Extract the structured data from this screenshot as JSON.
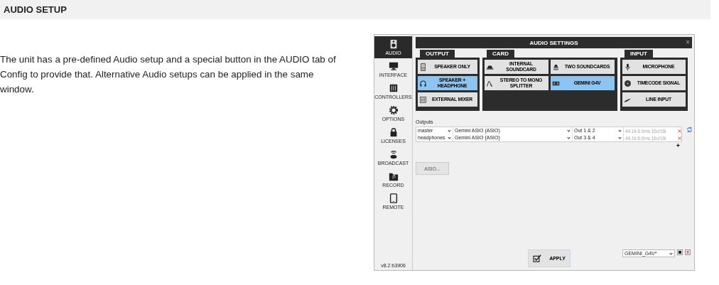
{
  "section_title": "AUDIO SETUP",
  "paragraph": "The unit has a pre-defined Audio setup and a special button in the AUDIO tab of Config to provide that. Alternative Audio setups can be applied in the same window.",
  "app": {
    "sidebar": [
      {
        "label": "AUDIO",
        "selected": true
      },
      {
        "label": "INTERFACE",
        "selected": false
      },
      {
        "label": "CONTROLLERS",
        "selected": false
      },
      {
        "label": "OPTIONS",
        "selected": false
      },
      {
        "label": "LICENSES",
        "selected": false
      },
      {
        "label": "BROADCAST",
        "selected": false
      },
      {
        "label": "RECORD",
        "selected": false
      },
      {
        "label": "REMOTE",
        "selected": false
      }
    ],
    "version": "v8.2 b3906",
    "window": {
      "title": "AUDIO SETTINGS",
      "close": "×"
    },
    "groups": [
      {
        "title": "OUTPUT",
        "items": [
          {
            "label": "SPEAKER ONLY",
            "selected": false
          },
          {
            "label": "SPEAKER + HEADPHONE",
            "selected": true
          },
          {
            "label": "EXTERNAL MIXER",
            "selected": false
          }
        ]
      },
      {
        "title": "CARD",
        "items": [
          {
            "label": "INTERNAL SOUNDCARD",
            "selected": false
          },
          {
            "label": "TWO SOUNDCARDS",
            "selected": false
          },
          {
            "label": "STEREO TO MONO SPLITTER",
            "selected": false
          },
          {
            "label": "GEMINI G4V",
            "selected": true
          }
        ]
      },
      {
        "title": "INPUT",
        "items": [
          {
            "label": "MICROPHONE",
            "selected": false
          },
          {
            "label": "TIMECODE SIGNAL",
            "selected": false
          },
          {
            "label": "LINE INPUT",
            "selected": false
          }
        ]
      }
    ],
    "outputs_label": "Outputs",
    "outputs": [
      {
        "name": "master",
        "device": "Gemini ASIO (ASIO)",
        "channels": "Out 1 & 2",
        "info": "44.1k 6.0ms 16o/16i"
      },
      {
        "name": "headphones",
        "device": "Gemini ASIO (ASIO)",
        "channels": "Out 3 & 4",
        "info": "44.1k 6.0ms 16o/16i"
      }
    ],
    "add": "+",
    "asio_button": "ASIO...",
    "apply": "APPLY",
    "preset": "GEMINI_G4V*"
  }
}
